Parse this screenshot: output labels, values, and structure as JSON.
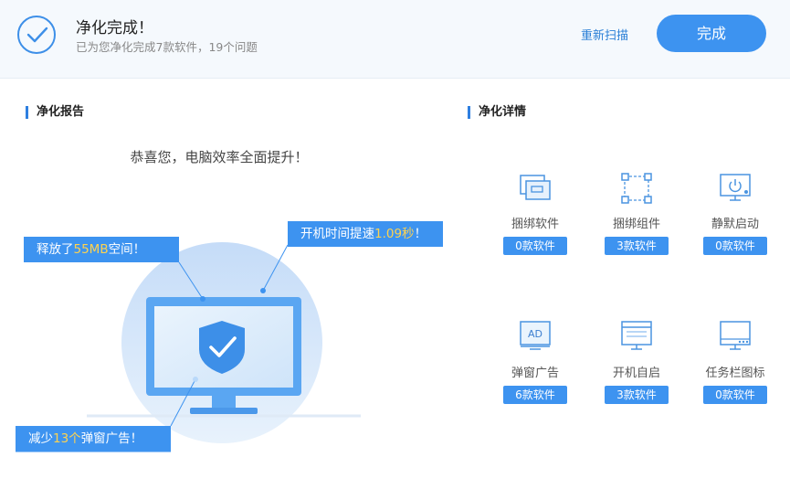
{
  "header": {
    "title": "净化完成！",
    "subtitle": "已为您净化完成7款软件，19个问题",
    "rescan_label": "重新扫描",
    "done_label": "完成"
  },
  "report": {
    "section_title": "净化报告",
    "congrats": "恭喜您，电脑效率全面提升！",
    "callout_space": {
      "prefix": "释放了",
      "value": "55MB",
      "suffix": "空间！"
    },
    "callout_boot": {
      "prefix": "开机时间提速",
      "value": "1.09秒",
      "suffix": "！"
    },
    "callout_ads": {
      "prefix": "减少",
      "value": "13个",
      "suffix": "弹窗广告！"
    }
  },
  "details": {
    "section_title": "净化详情",
    "items": [
      {
        "label": "捆绑软件",
        "count": "0款软件",
        "icon": "bundled-software-icon"
      },
      {
        "label": "捆绑组件",
        "count": "3款软件",
        "icon": "bundled-component-icon"
      },
      {
        "label": "静默启动",
        "count": "0款软件",
        "icon": "silent-startup-icon"
      },
      {
        "label": "弹窗广告",
        "count": "6款软件",
        "icon": "popup-ad-icon"
      },
      {
        "label": "开机自启",
        "count": "3款软件",
        "icon": "boot-autostart-icon"
      },
      {
        "label": "任务栏图标",
        "count": "0款软件",
        "icon": "taskbar-icon"
      }
    ]
  },
  "colors": {
    "accent": "#3d93f0",
    "highlight": "#ffd34f",
    "header_bg": "#f5f9fd"
  }
}
